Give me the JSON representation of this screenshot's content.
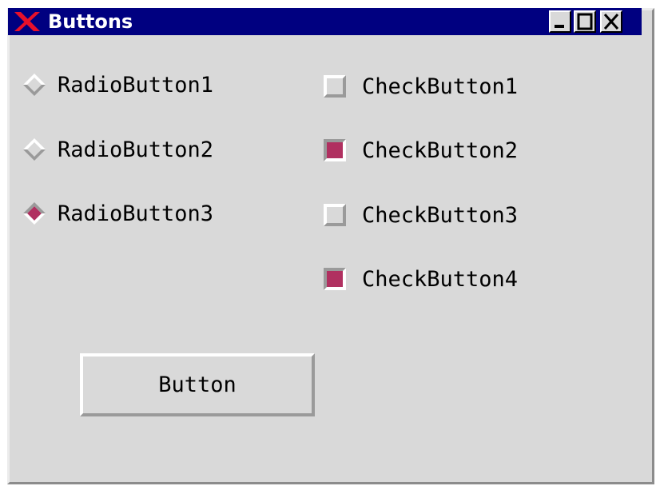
{
  "window": {
    "title": "Buttons",
    "logo_icon": "x-window-logo-icon",
    "controls": {
      "minimize_icon": "minimize-icon",
      "maximize_icon": "maximize-icon",
      "close_icon": "close-icon"
    }
  },
  "radios": [
    {
      "label": "RadioButton1",
      "selected": false
    },
    {
      "label": "RadioButton2",
      "selected": false
    },
    {
      "label": "RadioButton3",
      "selected": true
    }
  ],
  "checks": [
    {
      "label": "CheckButton1",
      "checked": false
    },
    {
      "label": "CheckButton2",
      "checked": true
    },
    {
      "label": "CheckButton3",
      "checked": false
    },
    {
      "label": "CheckButton4",
      "checked": true
    }
  ],
  "button": {
    "label": "Button"
  },
  "colors": {
    "title_bar": "#000080",
    "background": "#d9d9d9",
    "indicator_on": "#b03060",
    "logo": "#e8102a"
  }
}
